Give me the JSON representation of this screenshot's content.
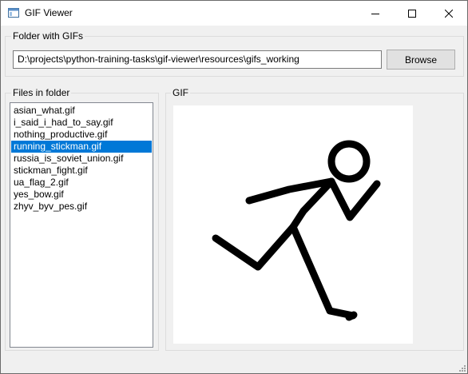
{
  "window": {
    "title": "GIF Viewer",
    "icon": "app-window-icon",
    "controls": [
      "minimize-icon",
      "maximize-icon",
      "close-icon"
    ]
  },
  "folder_group": {
    "title": "Folder with GIFs",
    "path_value": "D:\\projects\\python-training-tasks\\gif-viewer\\resources\\gifs_working",
    "browse_label": "Browse"
  },
  "files_group": {
    "title": "Files in folder",
    "items": [
      {
        "label": "asian_what.gif",
        "selected": false
      },
      {
        "label": "i_said_i_had_to_say.gif",
        "selected": false
      },
      {
        "label": "nothing_productive.gif",
        "selected": false
      },
      {
        "label": "running_stickman.gif",
        "selected": true
      },
      {
        "label": "russia_is_soviet_union.gif",
        "selected": false
      },
      {
        "label": "stickman_fight.gif",
        "selected": false
      },
      {
        "label": "ua_flag_2.gif",
        "selected": false
      },
      {
        "label": "yes_bow.gif",
        "selected": false
      },
      {
        "label": "zhyv_byv_pes.gif",
        "selected": false
      }
    ]
  },
  "gif_group": {
    "title": "GIF",
    "image": "running-stickman"
  },
  "colors": {
    "selection": "#0078d7",
    "window_bg": "#f0f0f0"
  }
}
